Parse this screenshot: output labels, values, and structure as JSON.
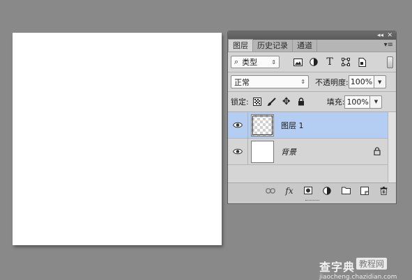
{
  "panel": {
    "collapse_glyph": "◂◂",
    "close_glyph": "✕",
    "tabs": [
      {
        "label": "图层"
      },
      {
        "label": "历史记录"
      },
      {
        "label": "通道"
      }
    ],
    "menu_glyph": "▾≡",
    "filter": {
      "kind_label": "类型",
      "search_glyph": "⌕",
      "arrow_glyph": "⇕",
      "icons": [
        "image-filter-icon",
        "adjustment-filter-icon",
        "text-filter-icon",
        "shape-filter-icon",
        "smart-object-filter-icon"
      ],
      "text_icon_glyph": "T"
    },
    "blend": {
      "mode": "正常",
      "arrow_glyph": "⇕",
      "opacity_label": "不透明度:",
      "opacity_value": "100%",
      "drop_glyph": "▼"
    },
    "lock": {
      "label": "锁定:",
      "fill_label": "填充:",
      "fill_value": "100%",
      "drop_glyph": "▼",
      "move_glyph": "✥"
    },
    "layers": [
      {
        "name": "图层 1",
        "selected": true
      },
      {
        "name": "背景",
        "selected": false
      }
    ],
    "bottom_icons": [
      "link-layers-icon",
      "fx-icon",
      "add-mask-icon",
      "adjustment-layer-icon",
      "new-group-icon",
      "new-layer-icon",
      "delete-icon"
    ],
    "fx_label": "fx"
  },
  "watermark": {
    "brand": "查字典",
    "tag": "教程网",
    "url": "jiaocheng.chazidian.com"
  },
  "colors": {
    "workspace": "#898989",
    "selected_layer": "#b4cdf3",
    "panel": "#d5d5d5"
  }
}
